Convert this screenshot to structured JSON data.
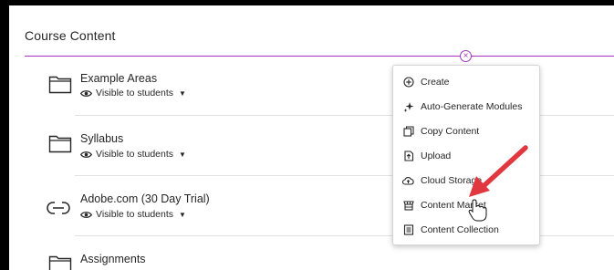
{
  "page": {
    "section_title": "Course Content"
  },
  "content_items": [
    {
      "title": "Example Areas",
      "icon": "folder-icon",
      "visibility": "Visible to students"
    },
    {
      "title": "Syllabus",
      "icon": "folder-icon",
      "visibility": "Visible to students"
    },
    {
      "title": "Adobe.com (30 Day Trial)",
      "icon": "link-icon",
      "visibility": "Visible to students"
    },
    {
      "title": "Assignments",
      "icon": "folder-icon",
      "visibility": ""
    }
  ],
  "add_menu": {
    "items": [
      {
        "label": "Create",
        "icon": "plus-circle-icon"
      },
      {
        "label": "Auto-Generate Modules",
        "icon": "sparkle-icon"
      },
      {
        "label": "Copy Content",
        "icon": "copy-icon"
      },
      {
        "label": "Upload",
        "icon": "upload-icon"
      },
      {
        "label": "Cloud Storage",
        "icon": "cloud-icon"
      },
      {
        "label": "Content Market",
        "icon": "store-icon"
      },
      {
        "label": "Content Collection",
        "icon": "collection-icon"
      }
    ]
  },
  "colors": {
    "accent_purple": "#a337c2",
    "annotation_arrow": "#e0383e",
    "text": "#262626",
    "divider": "#e2e2e2"
  }
}
